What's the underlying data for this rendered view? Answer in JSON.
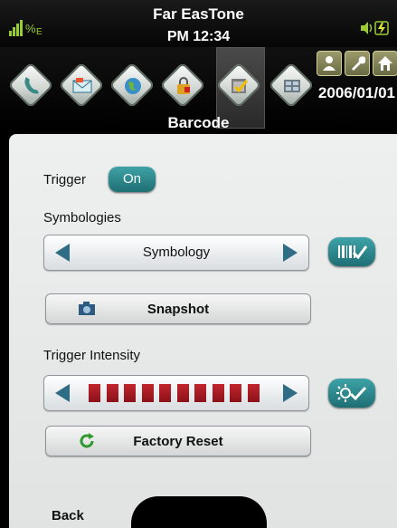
{
  "status": {
    "carrier": "Far EasTone",
    "time": "PM 12:34",
    "signal_icon": "signal-icon",
    "speaker_icon": "speaker-icon",
    "battery_icon": "battery-charging-icon",
    "date": "2006/01/01"
  },
  "launcher": {
    "apps": [
      {
        "name": "phone-app-icon"
      },
      {
        "name": "messaging-app-icon"
      },
      {
        "name": "internet-app-icon"
      },
      {
        "name": "security-app-icon"
      },
      {
        "name": "barcode-app-icon",
        "selected": true
      },
      {
        "name": "settings-app-icon"
      }
    ],
    "quick": [
      {
        "name": "user-icon"
      },
      {
        "name": "wrench-icon"
      },
      {
        "name": "home-icon"
      }
    ]
  },
  "page": {
    "title": "Barcode"
  },
  "trigger": {
    "label": "Trigger",
    "value": "On"
  },
  "symbologies": {
    "label": "Symbologies",
    "selected": "Symbology"
  },
  "snapshot": {
    "label": "Snapshot"
  },
  "intensity": {
    "label": "Trigger Intensity",
    "level": 10,
    "max": 10
  },
  "factory_reset": {
    "label": "Factory Reset"
  },
  "footer": {
    "back": "Back"
  },
  "colors": {
    "accent": "#2a8c92",
    "arrow": "#2f6c86",
    "intensity_bar": "#b01f27"
  }
}
